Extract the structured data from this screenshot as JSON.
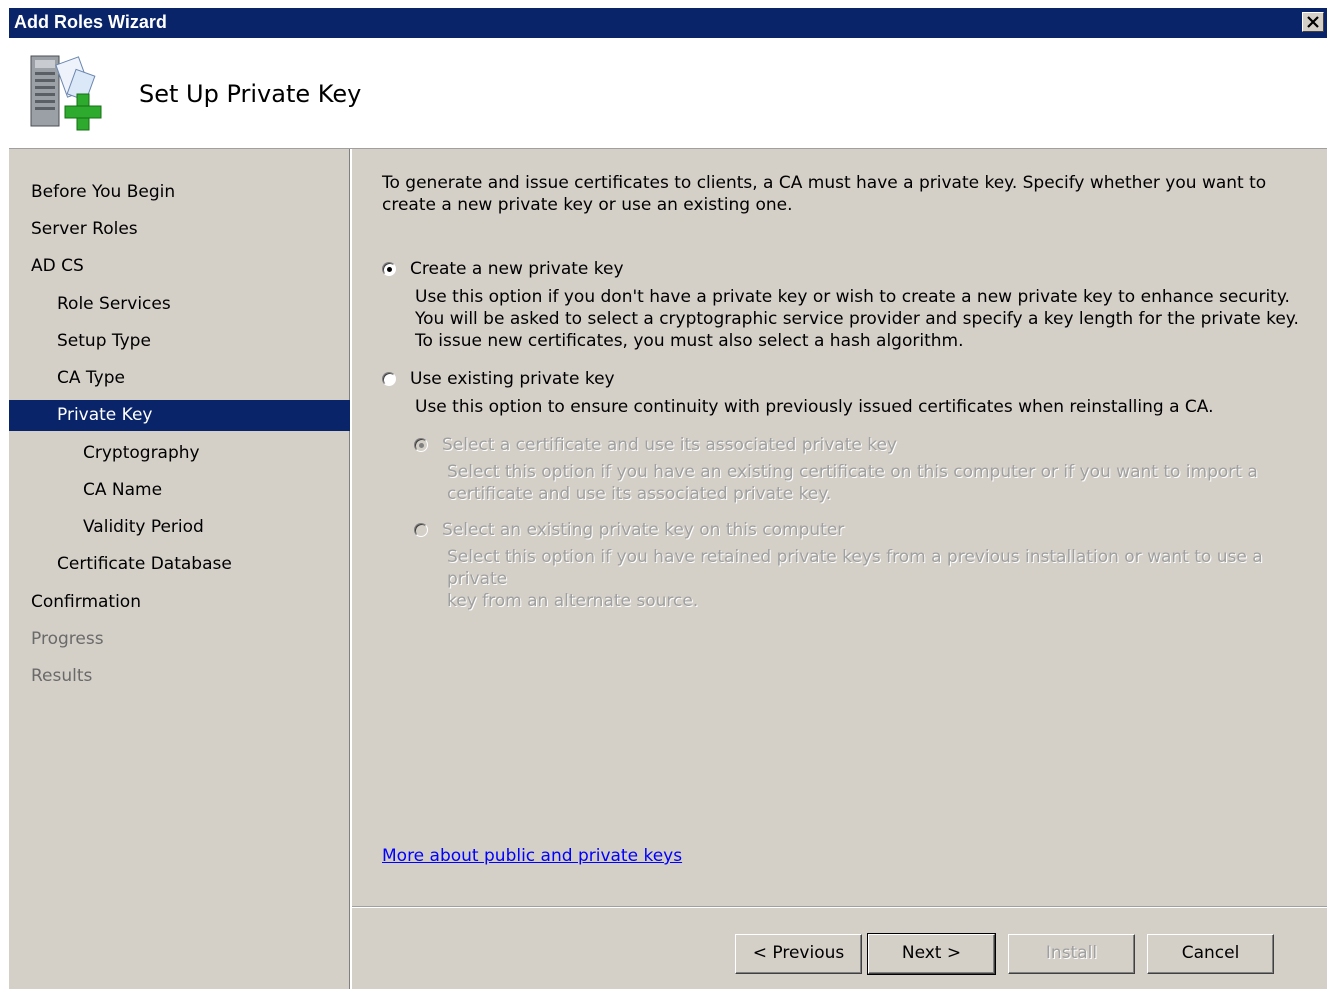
{
  "window": {
    "title": "Add Roles Wizard"
  },
  "header": {
    "page_title": "Set Up Private Key"
  },
  "sidebar": {
    "items": [
      {
        "label": "Before You Begin",
        "state": "normal"
      },
      {
        "label": "Server Roles",
        "state": "normal"
      },
      {
        "label": "AD CS",
        "state": "normal"
      },
      {
        "label": "Role Services",
        "state": "normal"
      },
      {
        "label": "Setup Type",
        "state": "normal"
      },
      {
        "label": "CA Type",
        "state": "normal"
      },
      {
        "label": "Private Key",
        "state": "selected"
      },
      {
        "label": "Cryptography",
        "state": "normal"
      },
      {
        "label": "CA Name",
        "state": "normal"
      },
      {
        "label": "Validity Period",
        "state": "normal"
      },
      {
        "label": "Certificate Database",
        "state": "normal"
      },
      {
        "label": "Confirmation",
        "state": "normal"
      },
      {
        "label": "Progress",
        "state": "disabled"
      },
      {
        "label": "Results",
        "state": "disabled"
      }
    ]
  },
  "main": {
    "intro_line1": "To generate and issue certificates to clients, a CA must have a private key. Specify whether you want to",
    "intro_line2": "create a new private key or use an existing one.",
    "option_new": {
      "label": "Create a new private key",
      "selected": true,
      "desc_line1": "Use this option if you don't have a private key or wish to create a new private key to enhance security.",
      "desc_line2": "You will be asked to select a cryptographic service provider and specify a key length for the private key.",
      "desc_line3": "To issue new certificates, you must also select a hash algorithm."
    },
    "option_existing": {
      "label": "Use existing private key",
      "selected": false,
      "desc_line1": "Use this option to ensure continuity with previously issued certificates when reinstalling a CA."
    },
    "sub_option_cert": {
      "label": "Select a certificate and use its associated private key",
      "selected": true,
      "enabled": false,
      "desc_line1": "Select this option if you have an existing certificate on this computer or if you want to import a",
      "desc_line2": "certificate and use its associated private key."
    },
    "sub_option_key": {
      "label": "Select an existing private key on this computer",
      "selected": false,
      "enabled": false,
      "desc_line1": "Select this option if you have retained private keys from a previous installation or want to use a private",
      "desc_line2": "key from an alternate source."
    },
    "help_link": "More about public and private keys"
  },
  "buttons": {
    "previous": "< Previous",
    "next": "Next >",
    "install": "Install",
    "cancel": "Cancel"
  },
  "colors": {
    "titlebar": "#0a246a",
    "dialog_bg": "#d4d0c8",
    "selection": "#0a246a",
    "link": "#0000ff"
  }
}
